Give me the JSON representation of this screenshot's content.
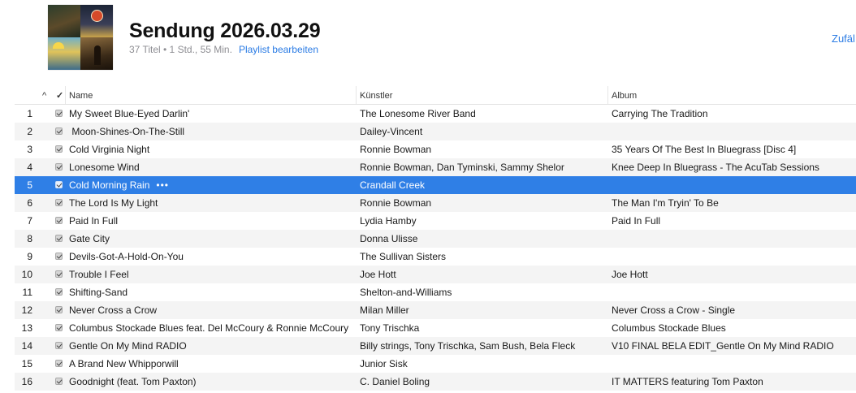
{
  "header": {
    "title": "Sendung 2026.03.29",
    "meta": "37 Titel • 1 Std., 55 Min.",
    "edit_link": "Playlist bearbeiten",
    "shuffle_label": "Zufäl"
  },
  "columns": {
    "sort_indicator": "^",
    "check_header": "✓",
    "name": "Name",
    "artist": "Künstler",
    "album": "Album"
  },
  "colors": {
    "accent": "#2a7be4",
    "selection": "#2f7fe6",
    "stripe": "#f4f4f4"
  },
  "selected_row_more": "•••",
  "tracks": [
    {
      "num": "1",
      "name": "My Sweet Blue-Eyed Darlin'",
      "artist": "The Lonesome River Band",
      "album": "Carrying The Tradition"
    },
    {
      "num": "2",
      "name": " Moon-Shines-On-The-Still",
      "artist": "Dailey-Vincent",
      "album": ""
    },
    {
      "num": "3",
      "name": "Cold Virginia Night",
      "artist": "Ronnie Bowman",
      "album": "35 Years Of The Best In Bluegrass [Disc 4]"
    },
    {
      "num": "4",
      "name": "Lonesome Wind",
      "artist": "Ronnie Bowman, Dan Tyminski, Sammy Shelor",
      "album": "Knee Deep In Bluegrass - The AcuTab Sessions"
    },
    {
      "num": "5",
      "name": "Cold Morning Rain",
      "artist": "Crandall Creek",
      "album": ""
    },
    {
      "num": "6",
      "name": "The Lord Is My Light",
      "artist": "Ronnie Bowman",
      "album": "The Man I'm Tryin' To Be"
    },
    {
      "num": "7",
      "name": "Paid In Full",
      "artist": "Lydia Hamby",
      "album": "Paid In Full"
    },
    {
      "num": "8",
      "name": "Gate City",
      "artist": "Donna Ulisse",
      "album": ""
    },
    {
      "num": "9",
      "name": "Devils-Got-A-Hold-On-You",
      "artist": "The Sullivan Sisters",
      "album": ""
    },
    {
      "num": "10",
      "name": "Trouble I Feel",
      "artist": "Joe Hott",
      "album": "Joe Hott"
    },
    {
      "num": "11",
      "name": "Shifting-Sand",
      "artist": "Shelton-and-Williams",
      "album": ""
    },
    {
      "num": "12",
      "name": "Never Cross a Crow",
      "artist": "Milan Miller",
      "album": "Never Cross a Crow - Single"
    },
    {
      "num": "13",
      "name": "Columbus Stockade Blues feat. Del McCoury & Ronnie McCoury",
      "artist": "Tony Trischka",
      "album": "Columbus Stockade Blues"
    },
    {
      "num": "14",
      "name": "Gentle On My Mind RADIO",
      "artist": "Billy strings, Tony Trischka, Sam Bush, Bela Fleck",
      "album": "V10 FINAL BELA EDIT_Gentle On My Mind RADIO"
    },
    {
      "num": "15",
      "name": "A Brand New Whipporwill",
      "artist": "Junior Sisk",
      "album": ""
    },
    {
      "num": "16",
      "name": "Goodnight (feat. Tom Paxton)",
      "artist": "C. Daniel Boling",
      "album": "IT MATTERS featuring Tom Paxton"
    }
  ]
}
